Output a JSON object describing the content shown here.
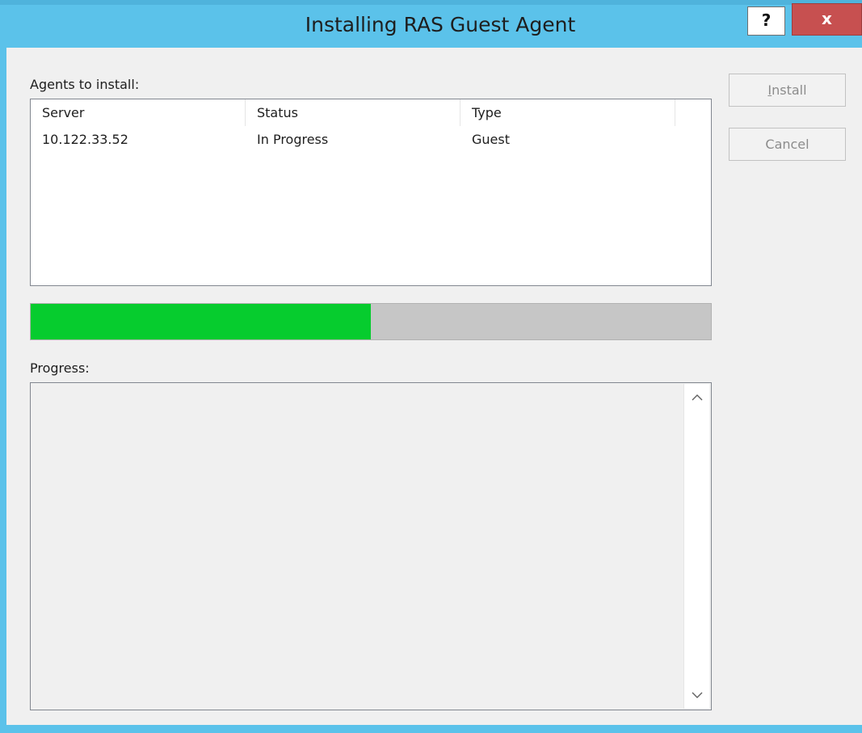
{
  "window": {
    "title": "Installing RAS Guest Agent",
    "help_label": "?",
    "close_label": "x"
  },
  "agents": {
    "label": "Agents to install:",
    "columns": [
      "Server",
      "Status",
      "Type"
    ],
    "rows": [
      {
        "server": "10.122.33.52",
        "status": "In Progress",
        "type": "Guest"
      }
    ]
  },
  "progress": {
    "fraction": 0.5,
    "label": "Progress:",
    "log_text": ""
  },
  "buttons": {
    "install_label_accel": "I",
    "install_label_rest": "nstall",
    "cancel_label": "Cancel"
  },
  "scrollbar": {
    "up_icon": "chevron-up-icon",
    "down_icon": "chevron-down-icon"
  },
  "colors": {
    "titlebar": "#5bc2ea",
    "close": "#c75050",
    "progress_fill": "#06cc2e",
    "progress_track": "#c6c6c6"
  }
}
